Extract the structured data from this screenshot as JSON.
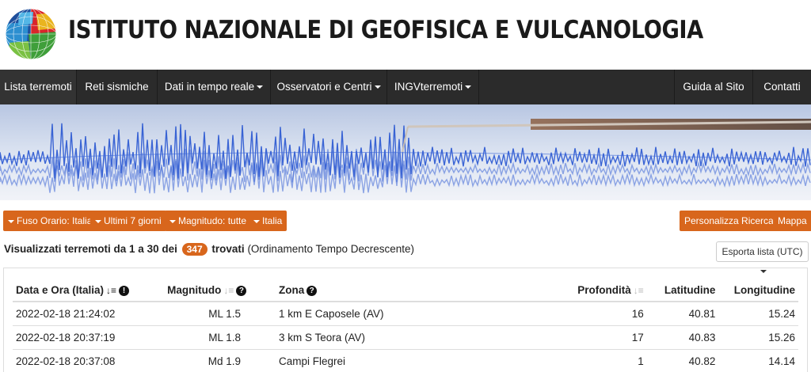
{
  "header": {
    "title": "ISTITUTO NAZIONALE DI GEOFISICA E VULCANOLOGIA"
  },
  "nav": {
    "left": [
      {
        "label": "Lista terremoti",
        "caret": false
      },
      {
        "label": "Reti sismiche",
        "caret": false
      },
      {
        "label": "Dati in tempo reale",
        "caret": true
      },
      {
        "label": "Osservatori e Centri",
        "caret": true
      },
      {
        "label": "INGVterremoti",
        "caret": true
      }
    ],
    "right": [
      {
        "label": "Guida al Sito"
      },
      {
        "label": "Contatti"
      }
    ]
  },
  "filters": {
    "fuso": "Fuso Orario: Italia",
    "periodo": "Ultimi 7 giorni",
    "magnitudo": "Magnitudo: tutte",
    "zona": "Italia",
    "personalizza": "Personalizza Ricerca",
    "mappa": "Mappa"
  },
  "summary": {
    "prefix": "Visualizzati terremoti da 1 a 30 dei",
    "count": "347",
    "found": "trovati",
    "order": "(Ordinamento Tempo Decrescente)"
  },
  "export": {
    "label": "Esporta lista (UTC)"
  },
  "table": {
    "headers": {
      "date": "Data e Ora (Italia)",
      "magnitude": "Magnitudo",
      "zone": "Zona",
      "depth": "Profondità",
      "lat": "Latitudine",
      "lon": "Longitudine"
    },
    "rows": [
      {
        "date": "2022-02-18 21:24:02",
        "mag": "ML 1.5",
        "zone": "1 km E Caposele (AV)",
        "depth": "16",
        "lat": "40.81",
        "lon": "15.24"
      },
      {
        "date": "2022-02-18 20:37:19",
        "mag": "ML 1.8",
        "zone": "3 km S Teora (AV)",
        "depth": "17",
        "lat": "40.83",
        "lon": "15.26"
      },
      {
        "date": "2022-02-18 20:37:08",
        "mag": "Md 1.9",
        "zone": "Campi Flegrei",
        "depth": "1",
        "lat": "40.82",
        "lon": "14.14"
      }
    ]
  },
  "colors": {
    "accent": "#d8661c",
    "navbar": "#2b2b2b"
  }
}
